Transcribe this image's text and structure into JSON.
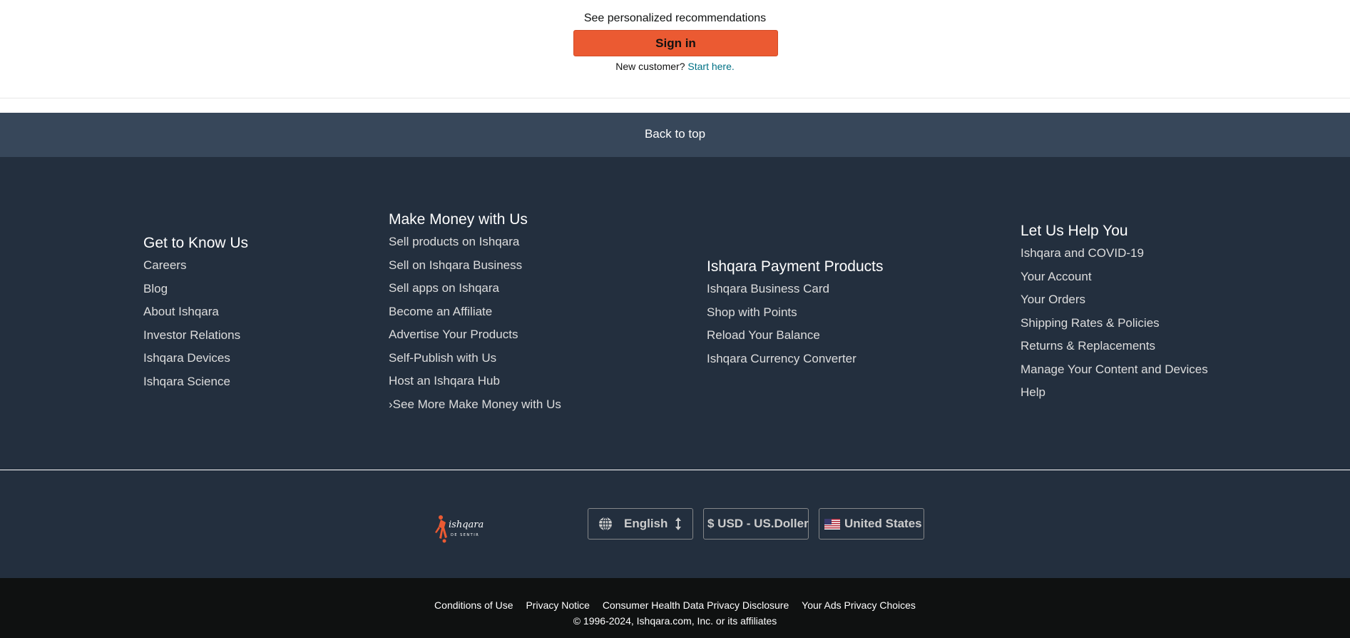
{
  "signin": {
    "prompt": "See personalized recommendations",
    "button_label": "Sign in",
    "new_customer_text": "New customer?",
    "start_here_link": "Start here."
  },
  "back_to_top": "Back to top",
  "footer_columns": [
    {
      "heading": "Get to Know Us",
      "links": [
        "Careers",
        "Blog",
        "About Ishqara",
        "Investor Relations",
        "Ishqara Devices",
        "Ishqara Science"
      ]
    },
    {
      "heading": "Make Money with Us",
      "links": [
        "Sell products on Ishqara",
        "Sell on Ishqara Business",
        "Sell apps on Ishqara",
        "Become an Affiliate",
        "Advertise Your Products",
        "Self-Publish with Us",
        "Host an Ishqara Hub",
        "›See More Make Money with Us"
      ]
    },
    {
      "heading": "Ishqara Payment Products",
      "links": [
        "Ishqara Business Card",
        "Shop with Points",
        "Reload Your Balance",
        "Ishqara Currency Converter"
      ]
    },
    {
      "heading": "Let Us Help You",
      "links": [
        "Ishqara and COVID-19",
        "Your Account",
        "Your Orders",
        "Shipping Rates & Policies",
        "Returns & Replacements",
        "Manage Your Content and Devices",
        "Help"
      ]
    }
  ],
  "footer_line": {
    "logo_text": "ishqara",
    "logo_subtext": "DE SENTIR",
    "language": "English",
    "currency": "$ USD - US.Doller",
    "country": "United States",
    "icons": [
      "globe-icon",
      "up-down-arrows-icon",
      "us-flag-icon"
    ]
  },
  "legal": {
    "links": [
      "Conditions of Use",
      "Privacy Notice",
      "Consumer Health Data Privacy Disclosure",
      "Your Ads Privacy Choices"
    ],
    "copyright": "© 1996-2024, Ishqara.com, Inc. or its affiliates"
  },
  "colors": {
    "signin_button": "#eb5a32",
    "back_to_top_bg": "#37475a",
    "footer_bg": "#232f3e",
    "legal_bg": "#0f1111",
    "link_teal": "#007185",
    "logo_orange": "#eb5a32"
  }
}
